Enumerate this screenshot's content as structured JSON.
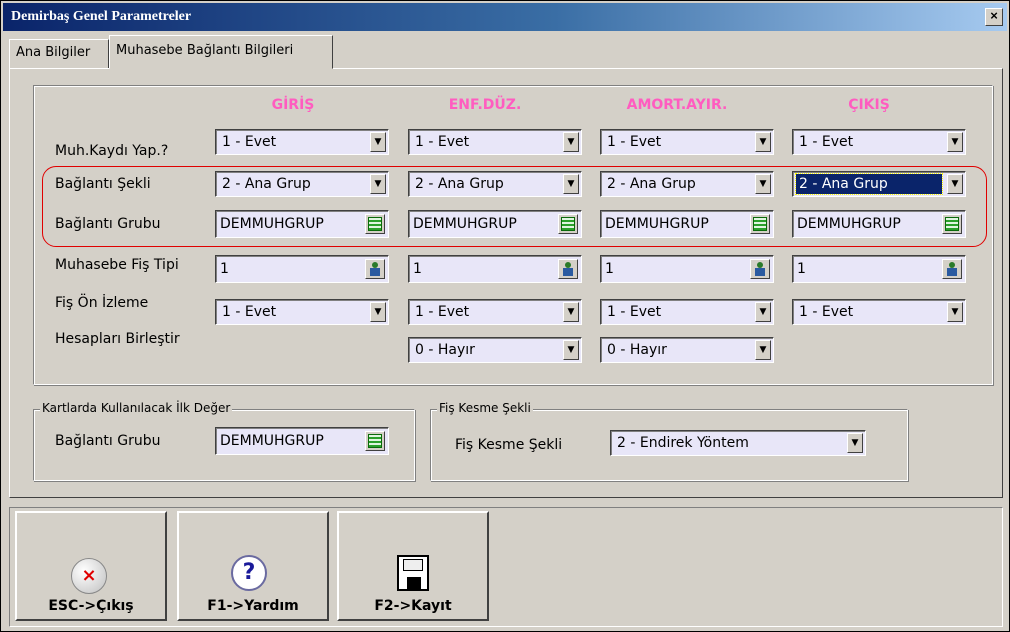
{
  "window": {
    "title": "Demirbaş Genel Parametreler",
    "close_label": "×"
  },
  "tabs": [
    {
      "label": "Ana Bilgiler"
    },
    {
      "label": "Muhasebe Bağlantı Bilgileri"
    }
  ],
  "columns": [
    "GİRİŞ",
    "ENF.DÜZ.",
    "AMORT.AYIR.",
    "ÇIKIŞ"
  ],
  "rows": {
    "muh_kaydi": {
      "label": "Muh.Kaydı Yap.?",
      "values": [
        "1 - Evet",
        "1 - Evet",
        "1 - Evet",
        "1 - Evet"
      ]
    },
    "baglanti_sekli": {
      "label": "Bağlantı Şekli",
      "values": [
        "2 - Ana Grup",
        "2 - Ana Grup",
        "2 - Ana Grup",
        "2 - Ana Grup"
      ]
    },
    "baglanti_grubu": {
      "label": "Bağlantı Grubu",
      "values": [
        "DEMMUHGRUP",
        "DEMMUHGRUP",
        "DEMMUHGRUP",
        "DEMMUHGRUP"
      ]
    },
    "fis_tipi": {
      "label": "Muhasebe Fiş Tipi",
      "values": [
        "1",
        "1",
        "1",
        "1"
      ]
    },
    "fis_on_izleme": {
      "label": "Fiş Ön İzleme",
      "values": [
        "1 - Evet",
        "1 - Evet",
        "1 - Evet",
        "1 - Evet"
      ]
    },
    "hesaplari_birlestir": {
      "label": "Hesapları Birleştir",
      "values": [
        "0 - Hayır",
        "0 - Hayır"
      ]
    }
  },
  "kartlarda": {
    "legend": "Kartlarda Kullanılacak İlk Değer",
    "label": "Bağlantı Grubu",
    "value": "DEMMUHGRUP"
  },
  "fis_kesme": {
    "legend": "Fiş Kesme Şekli",
    "label": "Fiş Kesme Şekli",
    "value": "2 - Endirek Yöntem"
  },
  "toolbar": {
    "esc_label": "ESC->Çıkış",
    "help_label": "F1->Yardım",
    "save_label": "F2->Kayıt"
  },
  "icons": {
    "dropdown_arrow": "▼",
    "lookup_grid": "grid-icon",
    "lookup_person": "person-icon",
    "exit_glyph": "×",
    "help_glyph": "?"
  }
}
